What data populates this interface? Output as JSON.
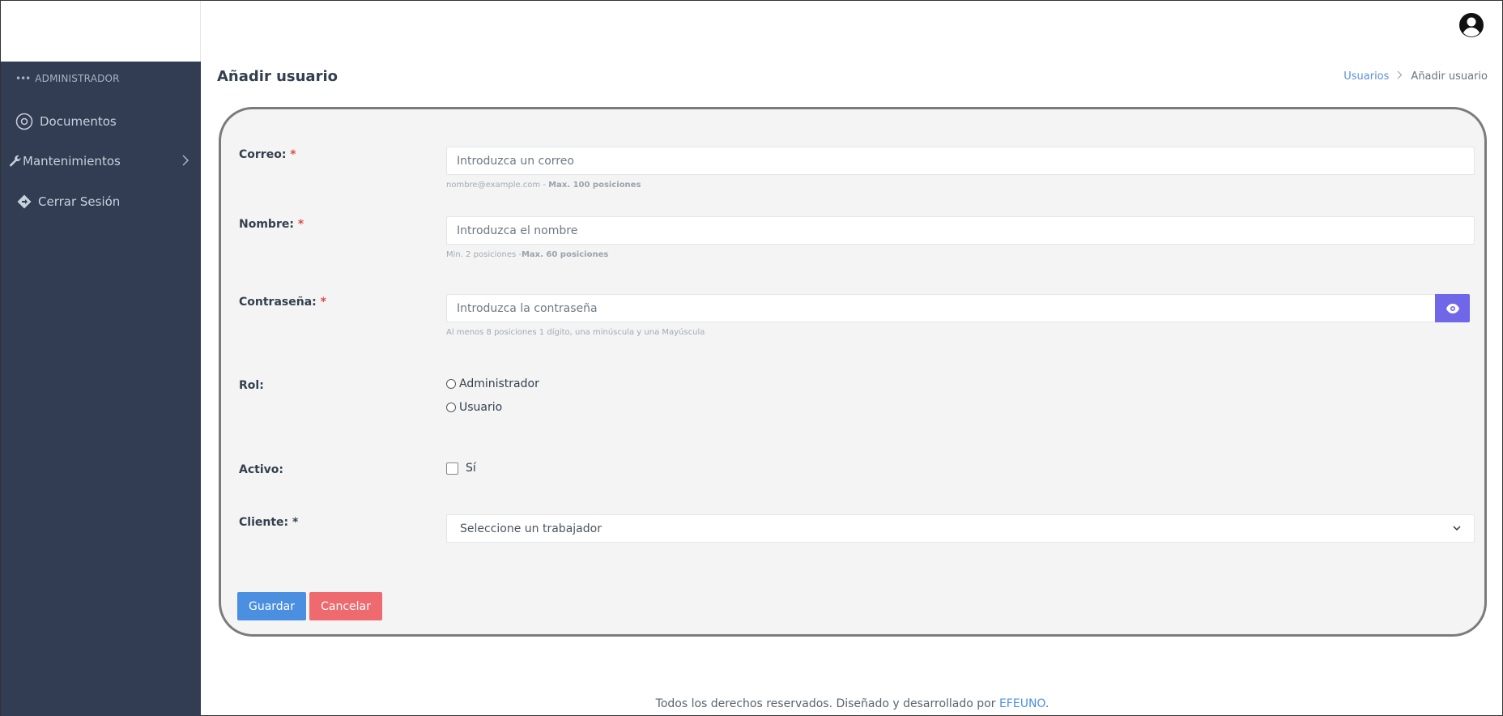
{
  "sidebar": {
    "section_label": "ADMINISTRADOR",
    "items": [
      {
        "label": "Documentos",
        "icon": "circle-dot-icon"
      },
      {
        "label": "Mantenimientos",
        "icon": "wrench-icon"
      },
      {
        "label": "Cerrar Sesión",
        "icon": "diamond-arrow-icon"
      }
    ]
  },
  "header": {
    "page_title": "Añadir usuario",
    "breadcrumb": {
      "link": "Usuarios",
      "current": "Añadir usuario"
    }
  },
  "form": {
    "email": {
      "label": "Correo:",
      "required_mark": "*",
      "placeholder": "Introduzca un correo",
      "help": "nombre@example.com - ",
      "help_bold": "Max. 100 posiciones"
    },
    "name": {
      "label": "Nombre:",
      "required_mark": "*",
      "placeholder": "Introduzca el nombre",
      "help": "Min. 2 posiciones -",
      "help_bold": "Max. 60 posiciones"
    },
    "password": {
      "label": "Contraseña:",
      "required_mark": "*",
      "placeholder": "Introduzca la contraseña",
      "help": "Al menos 8 posiciones 1 dígito, una minúscula y una Mayúscula"
    },
    "role": {
      "label": "Rol:",
      "options": [
        "Administrador",
        "Usuario"
      ]
    },
    "active": {
      "label": "Activo:",
      "option": "Sí"
    },
    "client": {
      "label": "Cliente: *",
      "selected": "Seleccione un trabajador"
    },
    "buttons": {
      "save": "Guardar",
      "cancel": "Cancelar"
    }
  },
  "footer": {
    "text": "Todos los derechos reservados. Diseñado y desarrollado por ",
    "link": "EFEUNO",
    "end": "."
  },
  "colors": {
    "sidebar_bg": "#323c52",
    "accent_blue": "#4a8fe0",
    "cancel_red": "#ee6a6f",
    "eye_button": "#7066e8"
  }
}
